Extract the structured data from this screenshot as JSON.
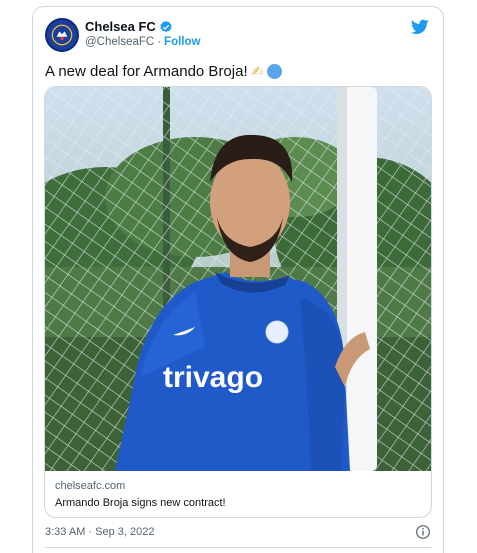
{
  "account": {
    "display_name": "Chelsea FC",
    "handle": "@ChelseaFC",
    "separator": "·",
    "follow_label": "Follow",
    "verified_icon": "verified-badge-icon",
    "logo_icon": "twitter-bird-icon"
  },
  "tweet": {
    "text": "A new deal for Armando Broja!",
    "emojis": [
      "writing-hand-emoji",
      "blue-circle-emoji"
    ]
  },
  "link_card": {
    "domain": "chelseafc.com",
    "title": "Armando Broja signs new contract!"
  },
  "photo": {
    "shirt_sponsor": "trivago"
  },
  "footer": {
    "timestamp": "3:33 AM · Sep 3, 2022",
    "info_icon": "info-circle-icon"
  },
  "colors": {
    "accent": "#1d9bf0",
    "chelsea_blue": "#1d4ed8",
    "border": "#cfd9de",
    "muted_text": "#536471"
  }
}
